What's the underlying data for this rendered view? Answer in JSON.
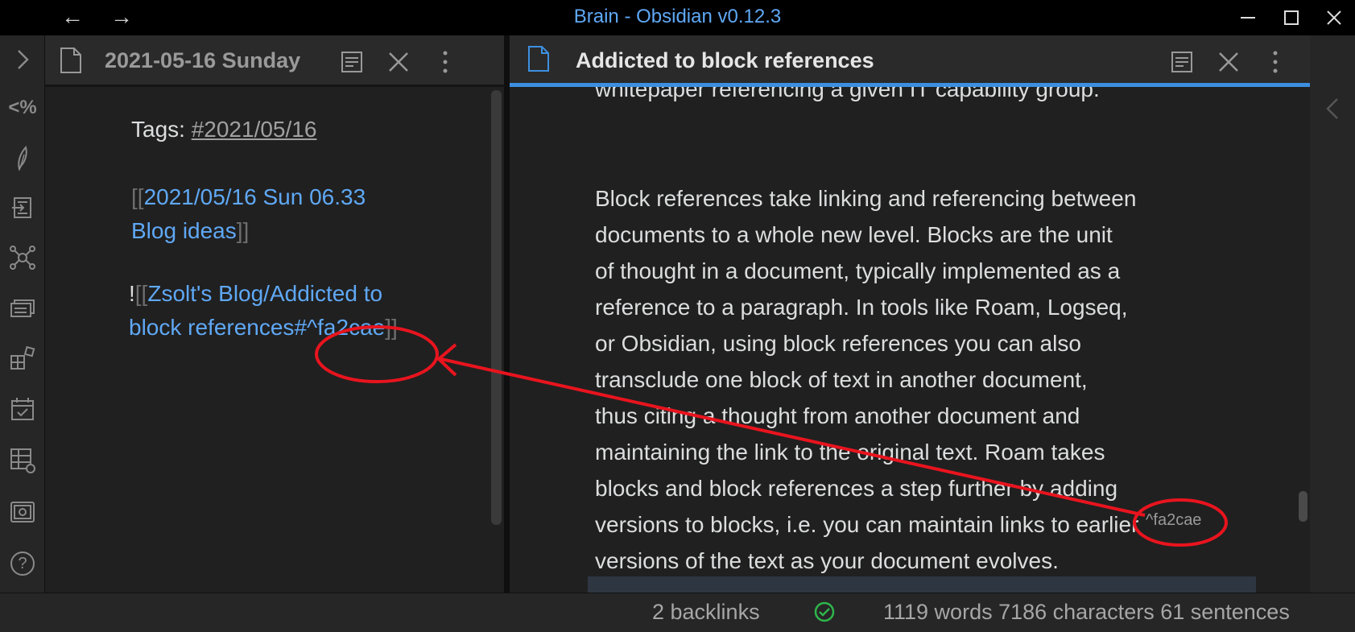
{
  "window": {
    "title": "Brain - Obsidian v0.12.3",
    "back_arrow": "←",
    "forward_arrow": "→"
  },
  "ribbon": {
    "icons": [
      "expand-icon",
      "templater-icon",
      "quill-icon",
      "import-icon",
      "graph-icon",
      "cards-icon",
      "blocks-icon",
      "calendar-icon",
      "table-settings-icon",
      "vault-icon",
      "help-icon"
    ],
    "templater_label": "<%",
    "help_label": "?"
  },
  "left_pane": {
    "title": "2021-05-16 Sunday",
    "tags_label": "Tags: ",
    "tag": "#2021/05/16",
    "open_bracket": "[[",
    "link1_line1": "2021/05/16 Sun 06.33",
    "link1_line2": "Blog ideas",
    "close_bracket": "]]",
    "embed_bang": "!",
    "embed_open": "[[",
    "embed_line1": "Zsolt's Blog/Addicted to",
    "embed_line2": "block references",
    "embed_ref": "#^fa2cae",
    "embed_close": "]]"
  },
  "right_pane": {
    "title": "Addicted to block references",
    "partial_line": "whitepaper referencing a given IT capability group.",
    "paragraph_lines": [
      "Block references take linking and referencing between",
      "documents to a whole new level. Blocks are the unit",
      "of thought in a document, typically implemented as a",
      "reference to a paragraph. In tools like Roam, Logseq,",
      "or Obsidian, using block references you can also",
      "transclude one block of text in another document,",
      "thus citing a thought from another document and",
      "maintaining the link to the original text. Roam takes",
      "blocks and block references a step further by adding",
      "versions to blocks, i.e. you can maintain links to earlier",
      "versions of the text as your document evolves."
    ],
    "block_id": "^fa2cae"
  },
  "statusbar": {
    "backlinks": "2 backlinks",
    "stats": "1119 words 7186 characters 61 sentences"
  },
  "colors": {
    "accent": "#3d8fe0",
    "link": "#5fa8f5",
    "annotation": "#e8141e"
  }
}
